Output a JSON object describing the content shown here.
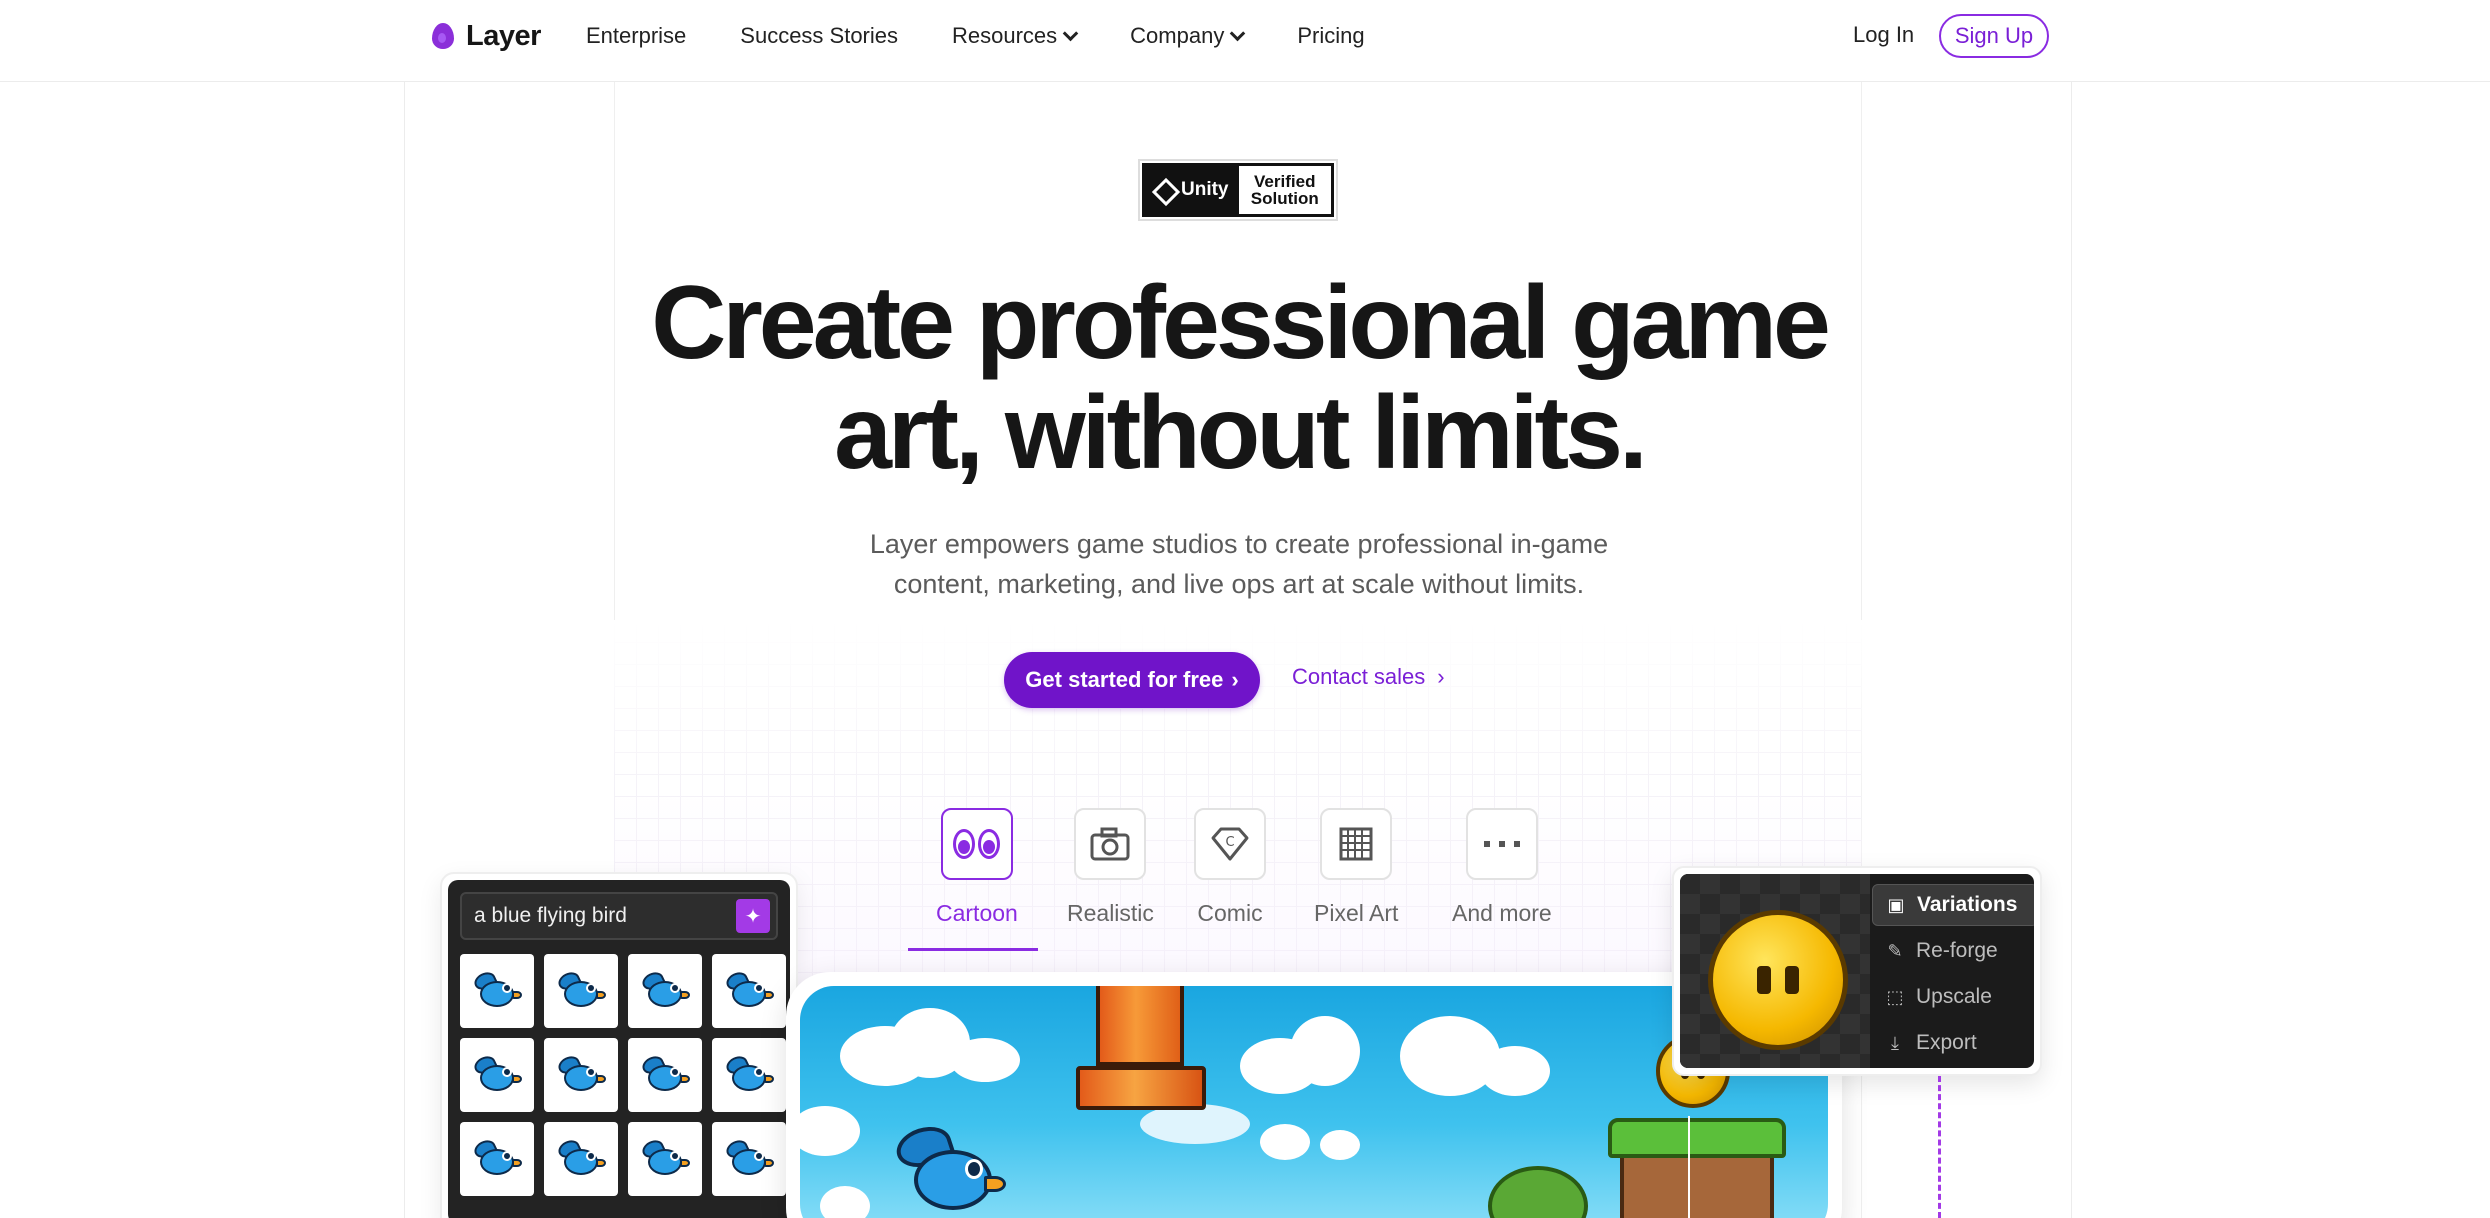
{
  "nav": {
    "logo": "Layer",
    "links": [
      {
        "label": "Enterprise",
        "dropdown": false
      },
      {
        "label": "Success Stories",
        "dropdown": false
      },
      {
        "label": "Resources",
        "dropdown": true
      },
      {
        "label": "Company",
        "dropdown": true
      },
      {
        "label": "Pricing",
        "dropdown": false
      }
    ],
    "login": "Log In",
    "signup": "Sign Up"
  },
  "badge": {
    "brand": "Unity",
    "line1": "Verified",
    "line2": "Solution"
  },
  "hero": {
    "title_line1": "Create professional game",
    "title_line2": "art, without limits.",
    "subtitle_line1": "Layer empowers game studios to create professional in-game",
    "subtitle_line2": "content, marketing, and live ops art at scale without limits.",
    "cta_primary": "Get started for free",
    "cta_secondary": "Contact sales"
  },
  "styles": {
    "active": "Cartoon",
    "tabs": [
      {
        "label": "Cartoon",
        "icon": "eyes-icon"
      },
      {
        "label": "Realistic",
        "icon": "camera-icon"
      },
      {
        "label": "Comic",
        "icon": "copyright-diamond-icon"
      },
      {
        "label": "Pixel Art",
        "icon": "pixel-grid-icon"
      },
      {
        "label": "And more",
        "icon": "ellipsis-icon"
      }
    ]
  },
  "generator": {
    "prompt": "a blue flying bird",
    "icon": "magic-wand-icon"
  },
  "variations_menu": {
    "items": [
      {
        "label": "Variations",
        "icon": "image-icon",
        "active": true
      },
      {
        "label": "Re-forge",
        "icon": "hammer-icon",
        "active": false
      },
      {
        "label": "Upscale",
        "icon": "upscale-icon",
        "active": false
      },
      {
        "label": "Export",
        "icon": "download-icon",
        "active": false
      }
    ]
  },
  "colors": {
    "brand": "#7014c9",
    "accent": "#8a2be2",
    "text": "#161616"
  }
}
